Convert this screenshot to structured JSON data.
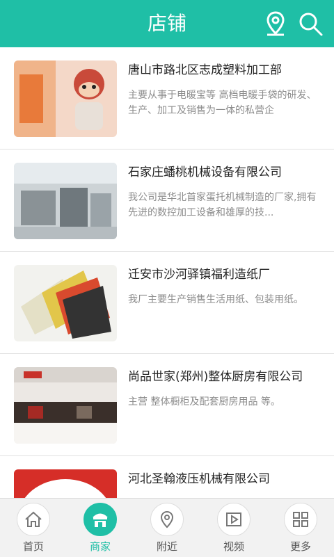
{
  "header": {
    "title": "店铺",
    "icons": [
      "location-pin-icon",
      "search-icon"
    ]
  },
  "stores": [
    {
      "name": "唐山市路北区志成塑料加工部",
      "desc": "主要从事于电暖宝等 高档电暖手袋的研发、生产、加工及销售为一体的私营企"
    },
    {
      "name": "石家庄蟠桃机械设备有限公司",
      "desc": "我公司是华北首家蛋托机械制造的厂家,拥有先进的数控加工设备和雄厚的技..."
    },
    {
      "name": "迁安市沙河驿镇福利造纸厂",
      "desc": "我厂主要生产销售生活用纸、包装用纸。"
    },
    {
      "name": "尚品世家(郑州)整体厨房有限公司",
      "desc": "主营 整体橱柜及配套厨房用品 等。"
    },
    {
      "name": "河北圣翰液压机械有限公司",
      "desc": ""
    }
  ],
  "tabs": [
    {
      "label": "首页",
      "icon": "home-icon"
    },
    {
      "label": "商家",
      "icon": "shop-icon"
    },
    {
      "label": "附近",
      "icon": "location-icon"
    },
    {
      "label": "视频",
      "icon": "video-icon"
    },
    {
      "label": "更多",
      "icon": "grid-icon"
    }
  ],
  "active_tab": "商家",
  "colors": {
    "accent": "#1fbfa6"
  }
}
